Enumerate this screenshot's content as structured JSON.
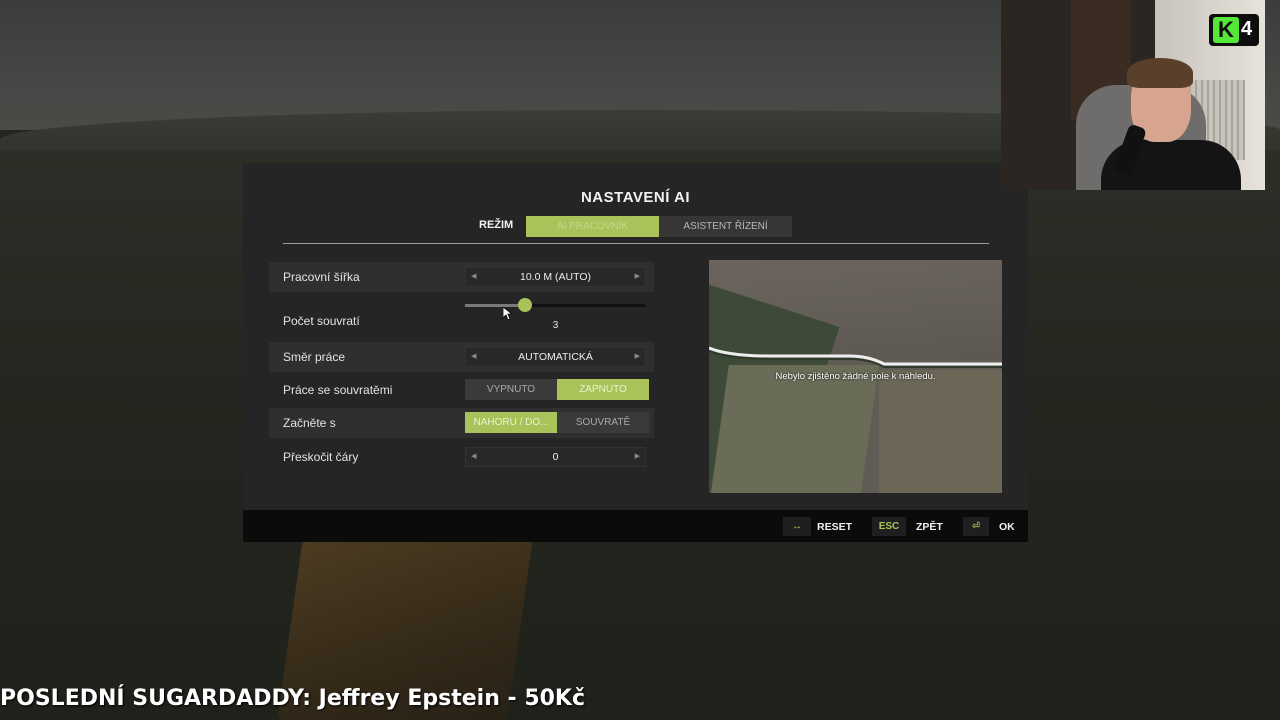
{
  "dialog": {
    "title": "NASTAVENÍ AI",
    "mode": {
      "label": "REŽIM",
      "tabs": [
        {
          "label": "AI PRACOVNÍK",
          "active": true
        },
        {
          "label": "ASISTENT ŘÍZENÍ",
          "active": false
        }
      ]
    },
    "settings": {
      "working_width": {
        "label": "Pracovní šířka",
        "value": "10.0 M (AUTO)"
      },
      "headland_count": {
        "label": "Počet souvratí",
        "value": "3",
        "slider_fraction": 0.33
      },
      "work_direction": {
        "label": "Směr práce",
        "value": "AUTOMATICKÁ"
      },
      "headland_work": {
        "label": "Práce se souvratěmi",
        "options": [
          "VYPNUTO",
          "ZAPNUTO"
        ],
        "selected": "ZAPNUTO"
      },
      "start_with": {
        "label": "Začněte s",
        "options": [
          "NAHORU / DO...",
          "SOUVRATĚ"
        ],
        "selected": "NAHORU / DO..."
      },
      "skip_lines": {
        "label": "Přeskočit čáry",
        "value": "0"
      }
    },
    "preview": {
      "message": "Nebylo zjištěno žádné pole k náhledu."
    },
    "footer": {
      "reset": {
        "key": "↔",
        "label": "RESET"
      },
      "back": {
        "key": "ESC",
        "label": "ZPĚT"
      },
      "ok": {
        "key": "⏎",
        "label": "OK"
      }
    }
  },
  "overlay": {
    "badge_letter": "K",
    "badge_number": "4",
    "ticker": "POSLEDNÍ SUGARDADDY: Jeffrey Epstein - 50Kč"
  },
  "colors": {
    "accent": "#a9c35a",
    "panel": "#252525",
    "footer": "#0b0b0b"
  }
}
